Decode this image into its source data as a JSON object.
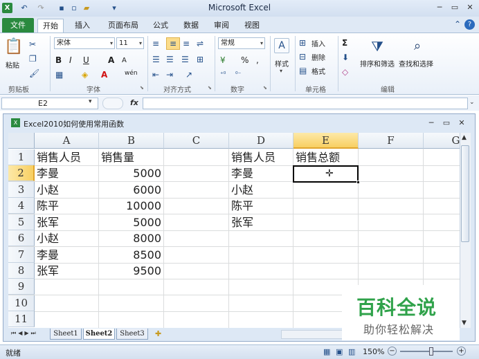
{
  "titlebar": {
    "title": "Microsoft Excel"
  },
  "tabs": {
    "file": "文件",
    "home": "开始",
    "insert": "插入",
    "layout": "页面布局",
    "formulas": "公式",
    "data": "数据",
    "review": "审阅",
    "view": "视图"
  },
  "ribbon": {
    "clipboard": {
      "paste": "粘贴",
      "label": "剪贴板"
    },
    "font": {
      "name": "宋体",
      "size": "11",
      "bold": "B",
      "italic": "I",
      "underline": "U",
      "grow": "A",
      "shrink": "A",
      "fontcolor": "A",
      "wen": "wén",
      "label": "字体"
    },
    "align": {
      "label": "对齐方式"
    },
    "number": {
      "format": "常规",
      "percent": "%",
      "comma": ",",
      "label": "数字"
    },
    "styles": {
      "label": "样式"
    },
    "cells": {
      "insert": "插入",
      "delete": "删除",
      "format": "格式",
      "label": "单元格"
    },
    "editing": {
      "sigma": "Σ",
      "sort": "排序和筛选",
      "find": "查找和选择",
      "label": "编辑"
    }
  },
  "formula_bar": {
    "name_box": "E2",
    "fx": "fx"
  },
  "workbook": {
    "title": "Excel2010如何使用常用函数"
  },
  "grid": {
    "columns": [
      "A",
      "B",
      "C",
      "D",
      "E",
      "F",
      "G"
    ],
    "rows": [
      "1",
      "2",
      "3",
      "4",
      "5",
      "6",
      "7",
      "8",
      "9",
      "10",
      "11"
    ],
    "A": [
      "销售人员",
      "李曼",
      "小赵",
      "陈平",
      "张军",
      "小赵",
      "李曼",
      "张军"
    ],
    "B": [
      "销售量",
      "5000",
      "6000",
      "10000",
      "5000",
      "8000",
      "8500",
      "9500"
    ],
    "D": [
      "销售人员",
      "李曼",
      "小赵",
      "陈平",
      "张军"
    ],
    "E": [
      "销售总额"
    ],
    "selected": "E2"
  },
  "sheets": [
    "Sheet1",
    "Sheet2",
    "Sheet3"
  ],
  "status": {
    "ready": "就绪",
    "zoom": "150%"
  },
  "watermark": {
    "title": "百科全说",
    "subtitle": "助你轻松解决"
  },
  "colors": {
    "accent": "#2a8a3f",
    "selection_header": "#f8cf62",
    "ribbon_border": "#a9bfd6",
    "watermark_text": "#2fa24a"
  }
}
